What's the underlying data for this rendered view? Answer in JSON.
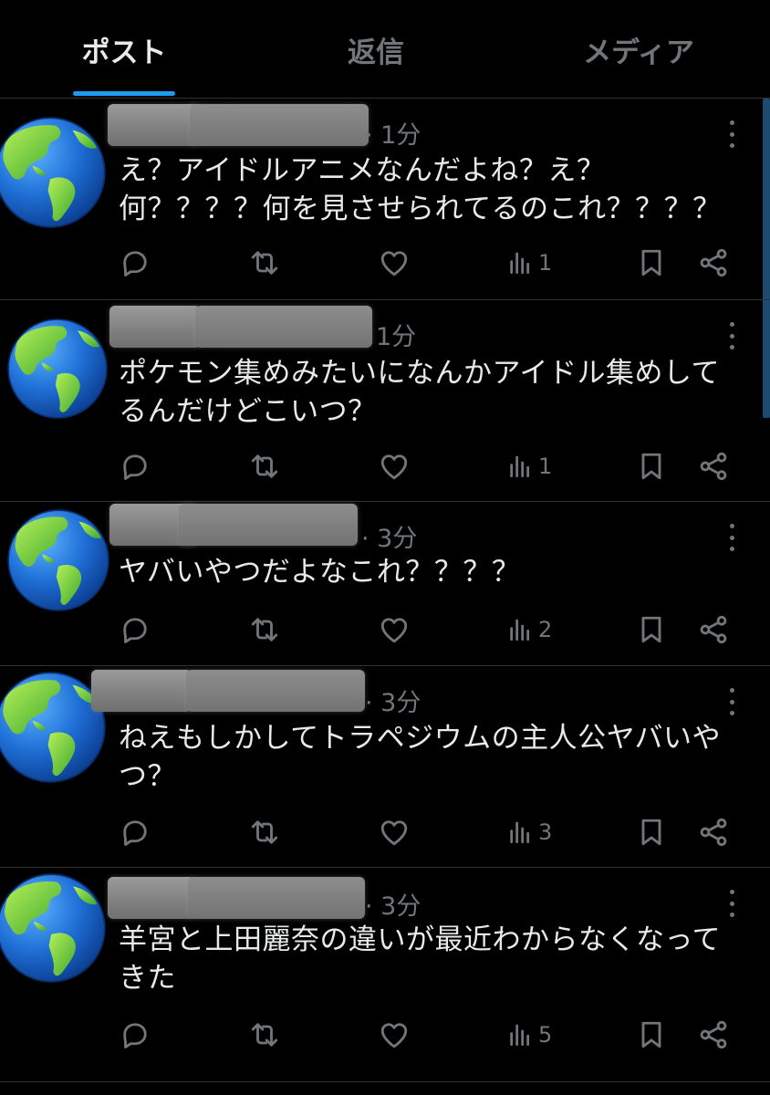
{
  "tabs": [
    {
      "label": "ポスト",
      "active": true
    },
    {
      "label": "返信",
      "active": false
    },
    {
      "label": "メディア",
      "active": false
    }
  ],
  "posts": [
    {
      "time": "· 1分",
      "text": "え？アイドルアニメなんだよね？え？\n何？？？？何を見させられてるのこれ？？？？",
      "views": "1"
    },
    {
      "time": "1分",
      "text": "ポケモン集めみたいになんかアイドル集めして\nるんだけどこいつ？",
      "views": "1"
    },
    {
      "time": "· 3分",
      "text": "ヤバいやつだよなこれ？？？？",
      "views": "2"
    },
    {
      "time": "· 3分",
      "text": "ねえもしかしてトラペジウムの主人公ヤバいや\nつ？",
      "views": "3"
    },
    {
      "time": "· 3分",
      "text": "羊宮と上田麗奈の違いが最近わからなくなって\nきた",
      "views": "5"
    }
  ],
  "icons": {
    "avatar": "globe-americas-emoji",
    "reply": "reply-icon",
    "repost": "repost-icon",
    "like": "heart-icon",
    "views": "analytics-icon",
    "bookmark": "bookmark-icon",
    "share": "share-icon",
    "more": "more-icon"
  },
  "colors": {
    "background": "#000000",
    "text": "#e7e9ea",
    "muted": "#71767b",
    "accent": "#1d9bf0",
    "divider": "#2f3336"
  }
}
